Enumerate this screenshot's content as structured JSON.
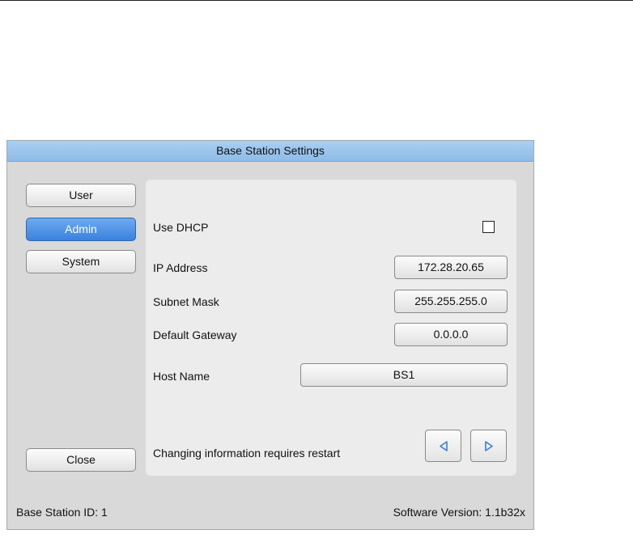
{
  "window": {
    "title": "Base Station Settings"
  },
  "nav": {
    "user_label": "User",
    "admin_label": "Admin",
    "system_label": "System",
    "close_label": "Close",
    "active_tab": "Admin"
  },
  "network": {
    "use_dhcp_label": "Use DHCP",
    "use_dhcp_checked": false,
    "ip_address_label": "IP Address",
    "ip_address_value": "172.28.20.65",
    "subnet_mask_label": "Subnet Mask",
    "subnet_mask_value": "255.255.255.0",
    "default_gateway_label": "Default Gateway",
    "default_gateway_value": "0.0.0.0",
    "host_name_label": "Host Name",
    "host_name_value": "BS1",
    "restart_note": "Changing information requires restart"
  },
  "paging": {
    "prev_icon": "triangle-left-icon",
    "next_icon": "triangle-right-icon"
  },
  "status_bar": {
    "base_station_id": "Base Station ID: 1",
    "software_version": "Software Version: 1.1b32x"
  },
  "colors": {
    "titlebar": "#a8d0f2",
    "active_tab": "#3a82de",
    "arrow_icon": "#3a7fd5",
    "window_bg": "#d9d9d9",
    "panel_bg": "#ececec"
  }
}
